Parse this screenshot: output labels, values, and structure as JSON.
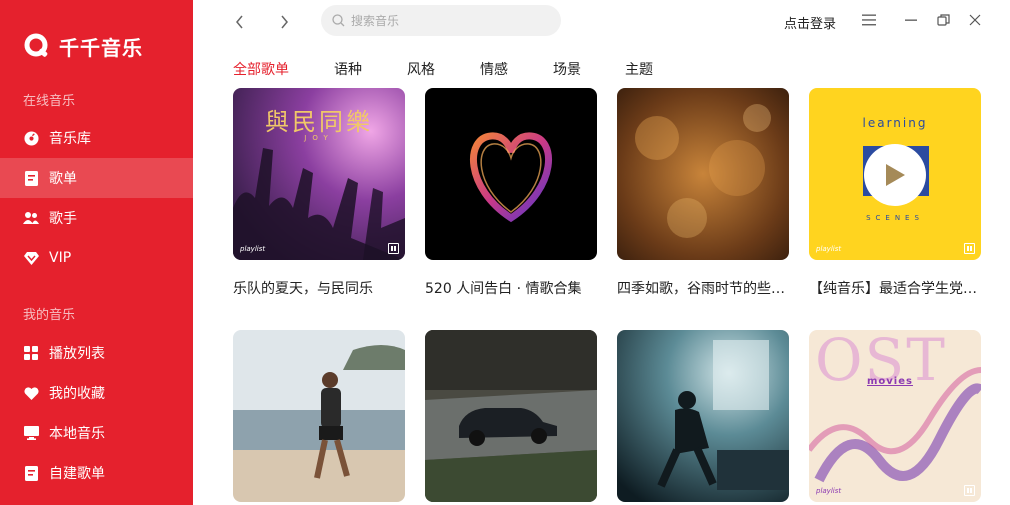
{
  "app": {
    "name": "千千音乐"
  },
  "sidebar": {
    "online_title": "在线音乐",
    "my_title": "我的音乐",
    "online_items": [
      {
        "label": "音乐库",
        "icon": "disc-icon"
      },
      {
        "label": "歌单",
        "icon": "playlist-icon",
        "active": true
      },
      {
        "label": "歌手",
        "icon": "singer-icon"
      },
      {
        "label": "VIP",
        "icon": "vip-diamond-icon"
      }
    ],
    "my_items": [
      {
        "label": "播放列表",
        "icon": "grid-icon"
      },
      {
        "label": "我的收藏",
        "icon": "heart-icon"
      },
      {
        "label": "本地音乐",
        "icon": "monitor-icon"
      },
      {
        "label": "自建歌单",
        "icon": "document-icon"
      }
    ]
  },
  "header": {
    "search_placeholder": "搜索音乐",
    "login_label": "点击登录"
  },
  "tabs": [
    {
      "label": "全部歌单",
      "active": true
    },
    {
      "label": "语种"
    },
    {
      "label": "风格"
    },
    {
      "label": "情感"
    },
    {
      "label": "场景"
    },
    {
      "label": "主题"
    }
  ],
  "playlists": [
    {
      "title": "乐队的夏天，与民同乐",
      "cover_text": "與民同樂",
      "cover_sub": "JOY",
      "tag": "playlist"
    },
    {
      "title": "520 人间告白 · 情歌合集"
    },
    {
      "title": "四季如歌，谷雨时节的些许惆怅"
    },
    {
      "title": "【纯音乐】最适合学生党的背景音乐",
      "cover_text": "learning",
      "cover_sub": "SCENES",
      "tag": "playlist"
    },
    {
      "title": ""
    },
    {
      "title": ""
    },
    {
      "title": ""
    },
    {
      "title": "",
      "cover_text": "OST",
      "cover_sub": "movies",
      "tag": "playlist"
    }
  ],
  "colors": {
    "brand": "#e5212d",
    "text": "#222222"
  }
}
